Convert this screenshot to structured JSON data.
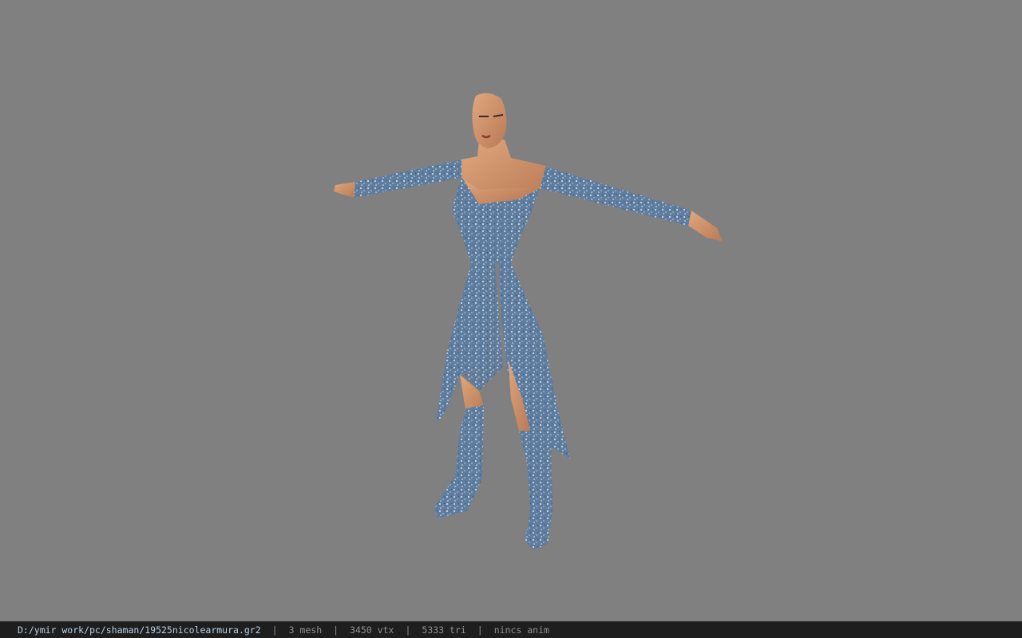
{
  "viewport": {
    "background": "#808080",
    "model_icon": "character-model-preview"
  },
  "status": {
    "file_path": "D:/ymir work/pc/shaman/19525nicolearmura.gr2",
    "separator": "|",
    "mesh_count": "3 mesh",
    "vertex_count": "3450 vtx",
    "triangle_count": "5333 tri",
    "anim_status": "nincs anim"
  },
  "colors": {
    "status_bg": "#1e1e1e",
    "path_text": "#b7d0e6",
    "stat_text": "#8f8f8f"
  }
}
